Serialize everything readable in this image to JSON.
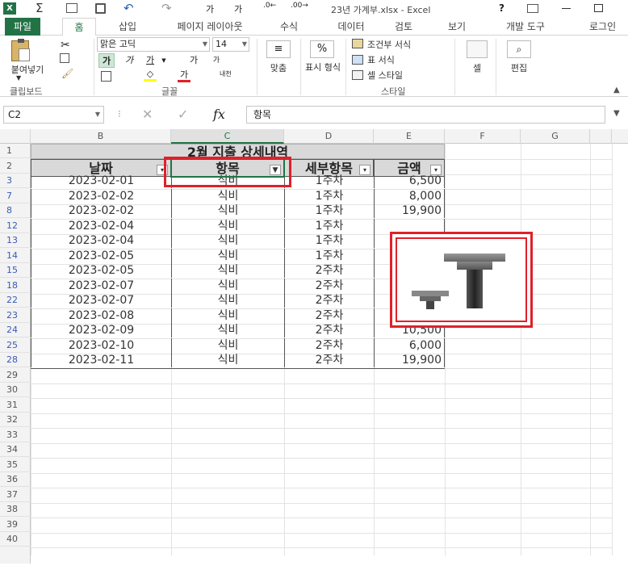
{
  "window": {
    "title": "23년 가계부.xlsx - Excel",
    "help": "?"
  },
  "tabs": [
    {
      "label": "파일"
    },
    {
      "label": "홈"
    },
    {
      "label": "삽입"
    },
    {
      "label": "페이지 레이아웃"
    },
    {
      "label": "수식"
    },
    {
      "label": "데이터"
    },
    {
      "label": "검토"
    },
    {
      "label": "보기"
    },
    {
      "label": "개발 도구"
    },
    {
      "label": "로그인"
    }
  ],
  "ribbon": {
    "paste_label": "붙여넣기",
    "clipboard_group": "클립보드",
    "font_name": "맑은 고딕",
    "font_size": "14",
    "font_group": "글꼴",
    "bold": "가",
    "italic": "가",
    "underline": "가",
    "grow_font": "가",
    "shrink_font": "가",
    "font_color_glyph": "가",
    "phonetic_glyph": "내천",
    "align_label": "맞춤",
    "number_label": "표시 형식",
    "percent": "%",
    "conditional_format": "조건부 서식",
    "format_as_table": "표 서식",
    "cell_styles": "셀 스타일",
    "styles_group": "스타일",
    "cells_label": "셀",
    "editing_label": "편집"
  },
  "formula_bar": {
    "name_box": "C2",
    "fx": "fx",
    "value": "항목"
  },
  "columns": [
    "B",
    "C",
    "D",
    "E",
    "F",
    "G"
  ],
  "selected_column": "C",
  "sheet": {
    "title": "2월 지출 상세내역",
    "headers": [
      "날짜",
      "항목",
      "세부항목",
      "금액"
    ],
    "rows": [
      {
        "row": "3",
        "date": "2023-02-01",
        "item": "식비",
        "sub": "1주차",
        "amount": "6,500"
      },
      {
        "row": "7",
        "date": "2023-02-02",
        "item": "식비",
        "sub": "1주차",
        "amount": "8,000"
      },
      {
        "row": "8",
        "date": "2023-02-02",
        "item": "식비",
        "sub": "1주차",
        "amount": "19,900"
      },
      {
        "row": "12",
        "date": "2023-02-04",
        "item": "식비",
        "sub": "1주차",
        "amount": ""
      },
      {
        "row": "13",
        "date": "2023-02-04",
        "item": "식비",
        "sub": "1주차",
        "amount": ""
      },
      {
        "row": "14",
        "date": "2023-02-05",
        "item": "식비",
        "sub": "1주차",
        "amount": ""
      },
      {
        "row": "15",
        "date": "2023-02-05",
        "item": "식비",
        "sub": "2주차",
        "amount": ""
      },
      {
        "row": "18",
        "date": "2023-02-07",
        "item": "식비",
        "sub": "2주차",
        "amount": ""
      },
      {
        "row": "22",
        "date": "2023-02-07",
        "item": "식비",
        "sub": "2주차",
        "amount": ""
      },
      {
        "row": "23",
        "date": "2023-02-08",
        "item": "식비",
        "sub": "2주차",
        "amount": ""
      },
      {
        "row": "24",
        "date": "2023-02-09",
        "item": "식비",
        "sub": "2주차",
        "amount": "10,500"
      },
      {
        "row": "25",
        "date": "2023-02-10",
        "item": "식비",
        "sub": "2주차",
        "amount": "6,000"
      },
      {
        "row": "28",
        "date": "2023-02-11",
        "item": "식비",
        "sub": "2주차",
        "amount": "19,900"
      }
    ],
    "empty_rows": [
      "29",
      "30",
      "31",
      "32",
      "33",
      "34",
      "35",
      "36",
      "37",
      "38",
      "39",
      "40"
    ]
  },
  "colors": {
    "excel_green": "#217346",
    "highlight_red": "#e0202a",
    "header_gray": "#d9d9d9"
  }
}
